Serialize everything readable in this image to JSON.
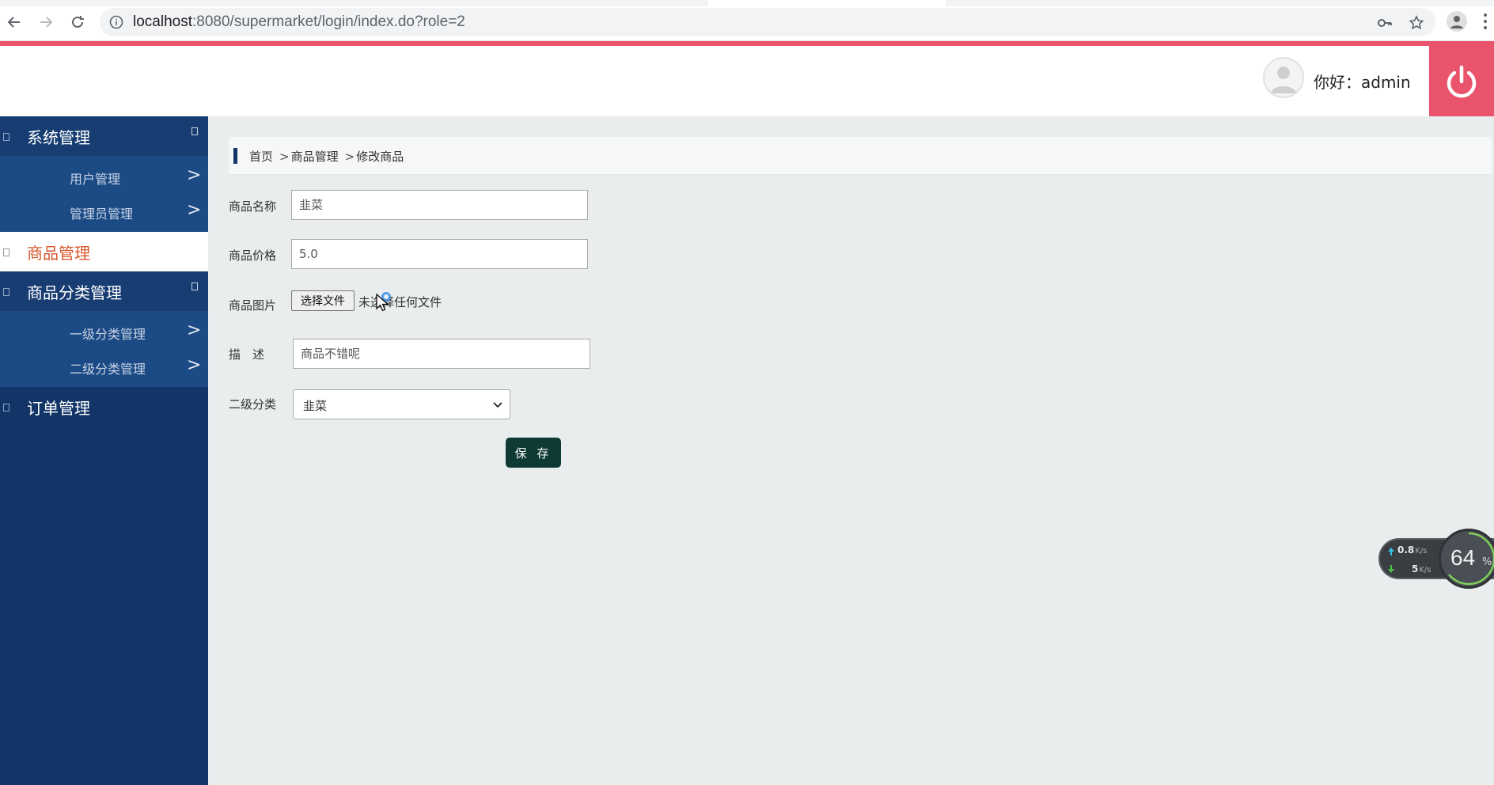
{
  "browser": {
    "url_host": "localhost",
    "url_rest": ":8080/supermarket/login/index.do?role=2"
  },
  "header": {
    "greeting": "你好：admin"
  },
  "sidebar": {
    "groups": [
      {
        "label": "系统管理",
        "items": [
          {
            "label": "用户管理"
          },
          {
            "label": "管理员管理"
          }
        ]
      },
      {
        "label": "商品管理",
        "items": []
      },
      {
        "label": "商品分类管理",
        "items": [
          {
            "label": "一级分类管理"
          },
          {
            "label": "二级分类管理"
          }
        ]
      },
      {
        "label": "订单管理",
        "items": []
      }
    ],
    "chevron": ">"
  },
  "breadcrumb": {
    "items": [
      "首页",
      "商品管理",
      "修改商品"
    ],
    "separator": ">"
  },
  "form": {
    "name_label": "商品名称",
    "name_value": "韭菜",
    "price_label": "商品价格",
    "price_value": "5.0",
    "image_label": "商品图片",
    "file_button": "选择文件",
    "file_status": "未选择任何文件",
    "desc_label": "描　述",
    "desc_value": "商品不错呢",
    "category_label": "二级分类",
    "category_value": "韭菜",
    "save_label": "保 存"
  },
  "net_widget": {
    "up_value": "0.8",
    "up_unit": "K/s",
    "down_value": "5",
    "down_unit": "K/s",
    "load_value": "64",
    "load_unit": "%"
  }
}
